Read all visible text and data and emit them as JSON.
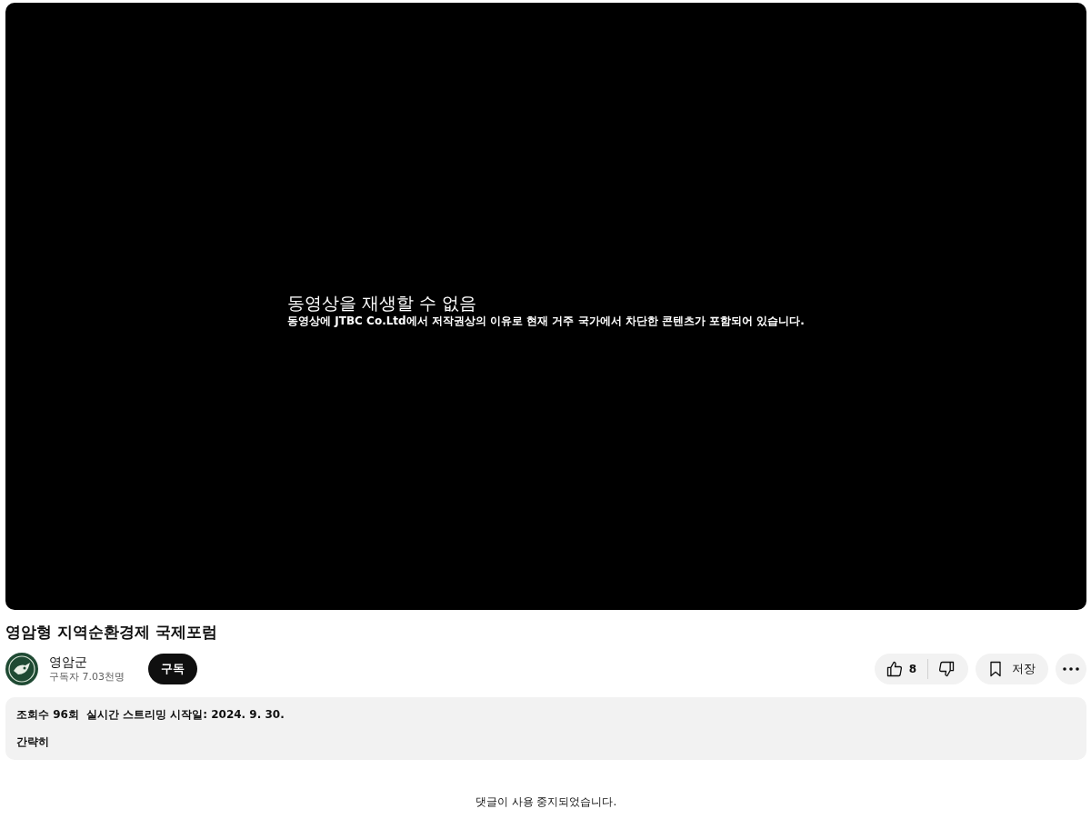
{
  "player": {
    "error_title": "동영상을 재생할 수 없음",
    "error_message": "동영상에 JTBC Co.Ltd에서 저작권상의 이유로 현재 거주 국가에서 차단한 콘텐츠가 포함되어 있습니다."
  },
  "video": {
    "title": "영암형 지역순환경제 국제포럼"
  },
  "channel": {
    "name": "영암군",
    "subscribers": "구독자 7.03천명",
    "subscribe_label": "구독"
  },
  "actions": {
    "likes": "8",
    "save_label": "저장"
  },
  "description": {
    "views": "조회수 96회",
    "stream_date": "실시간 스트리밍 시작일: 2024. 9. 30.",
    "text": "간략히"
  },
  "comments": {
    "notice": "댓글이 사용 중지되었습니다."
  }
}
